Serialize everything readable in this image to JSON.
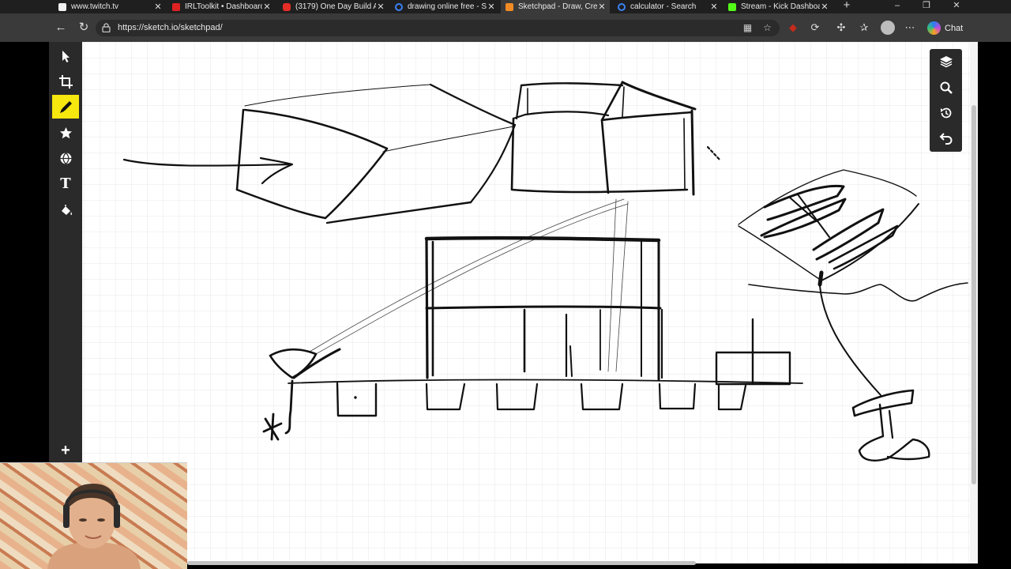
{
  "browser": {
    "tabs": [
      {
        "title": "www.twitch.tv",
        "favicon": "twitch-favicon",
        "active": false
      },
      {
        "title": "IRLToolkit • Dashboard",
        "favicon": "irltoolkit-favicon",
        "active": false
      },
      {
        "title": "(3179) One Day Build A",
        "favicon": "youtube-favicon",
        "active": false
      },
      {
        "title": "drawing online free - S",
        "favicon": "search-favicon",
        "active": false
      },
      {
        "title": "Sketchpad - Draw, Cre",
        "favicon": "sketchpad-favicon",
        "active": true
      },
      {
        "title": "calculator - Search",
        "favicon": "search-favicon",
        "active": false
      },
      {
        "title": "Stream - Kick Dashboa",
        "favicon": "kick-favicon",
        "active": false
      }
    ],
    "new_tab_label": "+",
    "window_controls": {
      "minimize": "–",
      "restore": "❐",
      "close": "✕"
    },
    "address_bar": {
      "url": "https://sketch.io/sketchpad/",
      "back_icon": "back-arrow-icon",
      "reload_icon": "reload-icon"
    },
    "chat_label": "Chat",
    "accent": "#c42b1c"
  },
  "app": {
    "name": "Sketchpad",
    "left_tools": [
      {
        "name": "select-pointer-icon"
      },
      {
        "name": "crop-icon"
      },
      {
        "name": "pencil-draw-icon",
        "active": true
      },
      {
        "name": "star-stamp-icon"
      },
      {
        "name": "globe-clipart-icon"
      },
      {
        "name": "text-tool-icon",
        "glyph": "T"
      },
      {
        "name": "paint-bucket-icon"
      },
      {
        "name": "add-icon",
        "glyph": "+"
      }
    ],
    "right_tools": [
      {
        "name": "layers-icon"
      },
      {
        "name": "zoom-search-icon"
      },
      {
        "name": "history-icon"
      },
      {
        "name": "undo-icon"
      }
    ],
    "active_color": "#f6e70e"
  }
}
